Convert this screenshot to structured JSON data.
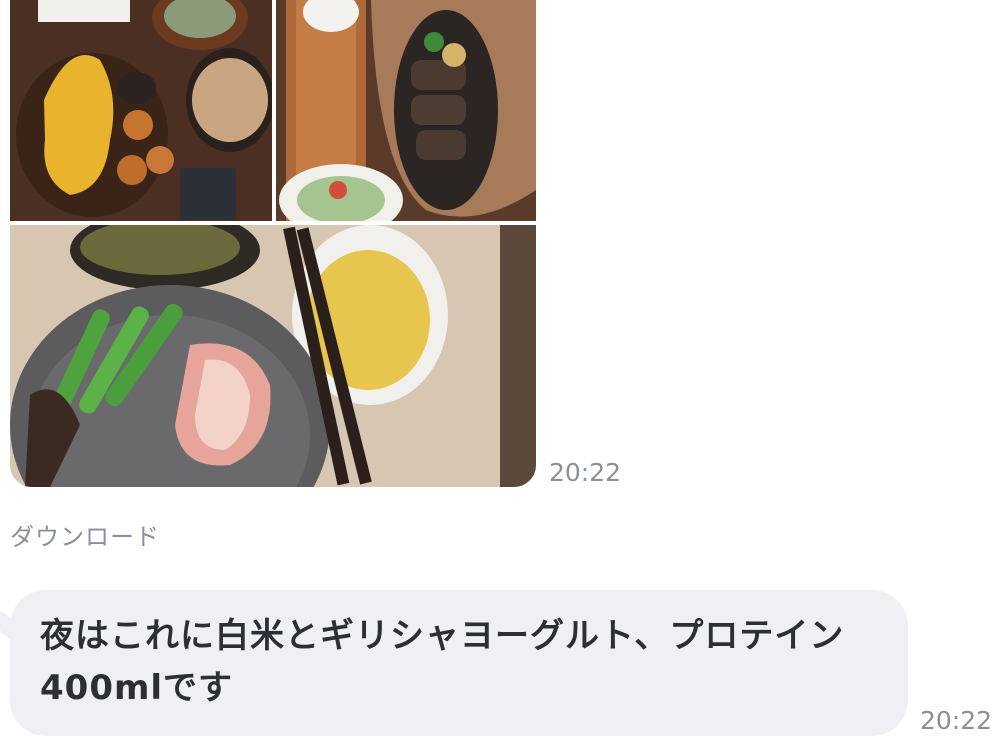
{
  "chat": {
    "photo_message": {
      "photos": [
        {
          "name": "photo-omelet-set"
        },
        {
          "name": "photo-hamburg-set"
        },
        {
          "name": "photo-shrimp-plate"
        }
      ],
      "timestamp": "20:22"
    },
    "download_label": "ダウンロード",
    "text_message": {
      "text": "夜はこれに白米とギリシャヨーグルト、プロテイン400mlです",
      "timestamp": "20:22",
      "bubble_color": "#eef0f3"
    }
  }
}
